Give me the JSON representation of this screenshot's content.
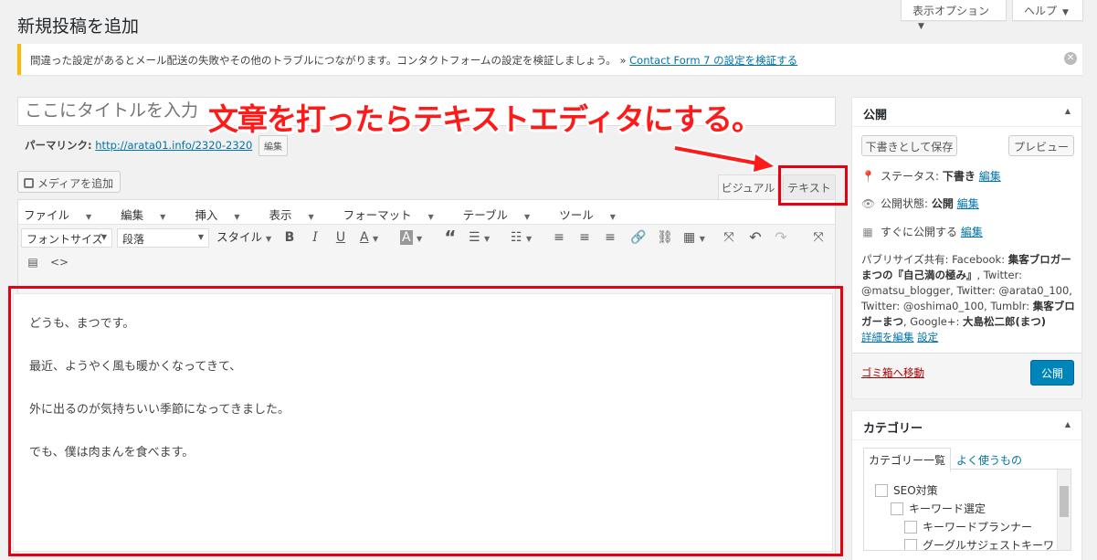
{
  "header": {
    "title": "新規投稿を追加",
    "screen_options": "表示オプション",
    "help": "ヘルプ"
  },
  "notice": {
    "text": "間違った設定があるとメール配送の失敗やその他のトラブルにつながります。コンタクトフォームの設定を検証しましょう。 » ",
    "link": "Contact Form 7 の設定を検証する"
  },
  "post": {
    "title_placeholder": "ここにタイトルを入力",
    "permalink_label": "パーマリンク:",
    "permalink_url": "http://arata01.info/2320-2320",
    "edit_button": "編集",
    "media_button": "メディアを追加",
    "tab_visual": "ビジュアル",
    "tab_text": "テキスト"
  },
  "editor": {
    "menus": [
      "ファイル",
      "編集",
      "挿入",
      "表示",
      "フォーマット",
      "テーブル",
      "ツール"
    ],
    "font_size": "フォントサイズ",
    "paragraph": "段落",
    "style": "スタイル",
    "paragraphs": [
      "どうも、まつです。",
      "最近、ようやく風も暖かくなってきて、",
      "外に出るのが気持ちいい季節になってきました。",
      "でも、僕は肉まんを食べます。"
    ]
  },
  "annotation": "文章を打ったらテキストエディタにする。",
  "publish": {
    "title": "公開",
    "save_draft": "下書きとして保存",
    "preview": "プレビュー",
    "status_label": "ステータス: ",
    "status_value": "下書き",
    "visibility_label": "公開状態: ",
    "visibility_value": "公開",
    "schedule_label": "すぐに公開する",
    "edit": "編集",
    "share_prefix": "パブリサイズ共有: Facebook: ",
    "share_fb": "集客ブロガーまつの『自己満の極み』",
    "share_tw1": ", Twitter: @matsu_blogger, Twitter: @arata0_100, Twitter: @oshima0_100, Tumblr: ",
    "share_tumblr": "集客ブロガーまつ",
    "share_gplus": ", Google+: ",
    "share_gplus_name": "大島松二郎(まつ)",
    "share_edit_details": "詳細を編集",
    "share_settings": "設定",
    "trash": "ゴミ箱へ移動",
    "publish_button": "公開"
  },
  "categories": {
    "title": "カテゴリー",
    "tab_all": "カテゴリー一覧",
    "tab_popular": "よく使うもの",
    "items": [
      "SEO対策",
      "キーワード選定",
      "キーワードプランナー",
      "グーグルサジェストキーワ"
    ]
  },
  "colors": {
    "accent": "#0073aa",
    "primary_button": "#0085ba",
    "annotation": "#ff1a1a",
    "notice_border": "#ffba00"
  }
}
